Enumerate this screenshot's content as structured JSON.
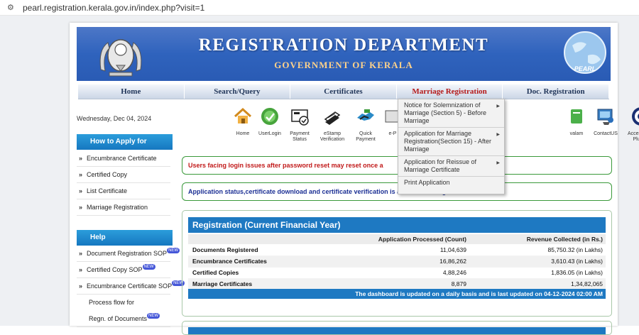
{
  "browser": {
    "url": "pearl.registration.kerala.gov.in/index.php?visit=1"
  },
  "header": {
    "title": "REGISTRATION DEPARTMENT",
    "subtitle": "GOVERNMENT OF KERALA",
    "globe_text": "PEARL"
  },
  "nav": [
    "Home",
    "Search/Query",
    "Certificates",
    "Marriage Registration",
    "Doc. Registration"
  ],
  "date": "Wednesday, Dec 04, 2024",
  "icons": [
    {
      "label": "Home",
      "icon": "house-icon"
    },
    {
      "label": "UserLogin",
      "icon": "user-login-icon"
    },
    {
      "label": "Payment Status",
      "icon": "payment-status-icon"
    },
    {
      "label": "eStamp Verification",
      "icon": "estamp-icon"
    },
    {
      "label": "Quick Payment",
      "icon": "quick-payment-icon"
    },
    {
      "label": "e-P",
      "icon": "e-payment-icon"
    },
    {
      "label": "valam",
      "icon": "valam-icon"
    },
    {
      "label": "ContactUS",
      "icon": "contact-icon"
    },
    {
      "label": "Accessibility Plugins",
      "icon": "accessibility-icon"
    }
  ],
  "how_to_apply": {
    "title": "How to Apply for",
    "items": [
      "Encumbrance Certificate",
      "Certified Copy",
      "List Certificate",
      "Marriage Registration"
    ]
  },
  "help": {
    "title": "Help",
    "items": [
      "Document Registration SOP",
      "Certified Copy SOP",
      "Encumbrance Certificate SOP",
      "Process flow for",
      "Regn. of Documents"
    ],
    "new_badge": "NEW"
  },
  "notices": {
    "login": "Users facing login issues after password reset may reset once a",
    "status": "Application status,certificate download and certificate verification is available through"
  },
  "registration": {
    "title": "Registration (Current Financial Year)",
    "columns": [
      "",
      "Application Processed (Count)",
      "Revenue Collected (in Rs.)"
    ],
    "rows": [
      [
        "Documents Registered",
        "11,04,639",
        "85,750.32 (in Lakhs)"
      ],
      [
        "Encumbrance Certificates",
        "16,86,262",
        "3,610.43 (in Lakhs)"
      ],
      [
        "Certified Copies",
        "4,88,246",
        "1,836.05 (in Lakhs)"
      ],
      [
        "Marriage Certificates",
        "8,879",
        "1,34,82,065"
      ]
    ],
    "footer": "The dashboard is updated on a daily basis and is last updated on 04-12-2024 02:00 AM"
  },
  "dropdown": [
    "Notice for Solemnization of Marriage (Section 5) - Before Marriage",
    "Application for Marriage Registration(Section 15) - After Marriage",
    "Application for Reissue of Marriage Certificate",
    "Print Application"
  ],
  "colors": {
    "banner_blue": "#2f63bd",
    "nav_active": "#b41818",
    "table_header": "#1e79c2",
    "notice_border": "#3b9a3b"
  }
}
